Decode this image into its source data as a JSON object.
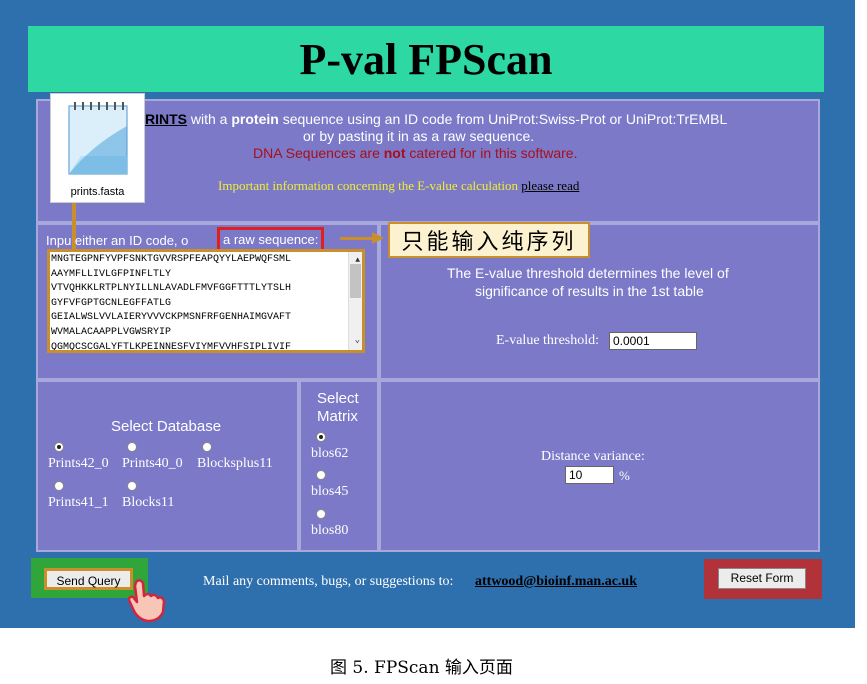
{
  "page": {
    "title": "P-val FPScan"
  },
  "intro": {
    "line1_a": "RINTS",
    "line1_b": " with a ",
    "line1_c": "protein",
    "line1_d": " sequence using an ID code from UniProt:Swiss-Prot or UniProt:TrEMBL",
    "line2": "or by pasting it in as a raw sequence.",
    "line3_a": "DNA Sequences are ",
    "line3_b": "not",
    "line3_c": " catered for in this software.",
    "evalue_info": "Important information concerning the E-value calculation",
    "evalue_link": "please read"
  },
  "file_icon": {
    "label": "prints.fasta"
  },
  "input": {
    "label_a": "Inpu",
    "label_b": " either an ID code, o",
    "label_highlight": "a raw sequence:",
    "sequence_lines": [
      "MNGTEGPNFYVPFSNKTGVVRSPFEAPQYYLAEPWQFSML",
      "AAYMFLLIVLGFPINFLTLY",
      "VTVQHKKLRTPLNYILLNLAVADLFMVFGGFTTTLYTSLH",
      "GYFVFGPTGCNLEGFFATLG",
      "GEIALWSLVVLAIERYVVVCKPMSNFRFGENHAIMGVAFT",
      "WVMALACAAPPLVGWSRYIP",
      "QGMQCSCGALYFTLKPEINNESFVIYMFVVHFSIPLIVIF"
    ]
  },
  "callout": {
    "text": "只能输入纯序列"
  },
  "threshold": {
    "desc_line1": "The E-value threshold determines the level of",
    "desc_line2": "significance of results in the 1st table",
    "label": "E-value threshold:",
    "value": "0.0001"
  },
  "database": {
    "title": "Select Database",
    "options": [
      "Prints42_0",
      "Prints40_0",
      "Blocksplus11",
      "Prints41_1",
      "Blocks11"
    ],
    "selected": "Prints42_0"
  },
  "matrix": {
    "title_line1": "Select",
    "title_line2": "Matrix",
    "options": [
      "blos62",
      "blos45",
      "blos80"
    ],
    "selected": "blos62"
  },
  "distance": {
    "label": "Distance variance:",
    "value": "10",
    "unit": "%"
  },
  "footer": {
    "send": "Send Query",
    "mail_text": "Mail any comments, bugs, or suggestions to:",
    "email": "attwood@bioinf.man.ac.uk",
    "reset": "Reset Form"
  },
  "caption": {
    "text": "图 5. FPScan 输入页面"
  },
  "colors": {
    "background": "#2e6fad",
    "title_bar": "#2dd8a3",
    "panel": "#7b79c8",
    "highlight_red": "#e02020",
    "annotation_orange": "#c98f2a",
    "send_frame": "#2fa53a",
    "reset_frame": "#b2323a"
  }
}
